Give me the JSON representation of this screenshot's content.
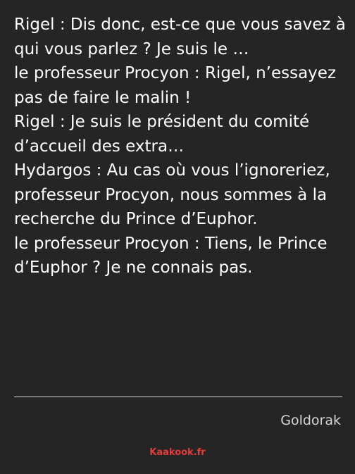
{
  "quote": {
    "lines": [
      "Rigel : Dis donc, est-ce que vous savez à qui vous parlez ? Je suis le …",
      "le professeur Procyon : Rigel, n’essayez pas de faire le malin !",
      "Rigel : Je suis le président du comité d’accueil des extra…",
      "Hydargos : Au cas où vous l’ignoreriez, professeur Procyon, nous sommes à la recherche du Prince d’Euphor.",
      "le professeur Procyon : Tiens, le Prince d’Euphor ? Je ne connais pas."
    ]
  },
  "author": "Goldorak",
  "site": "Kaakook.fr",
  "colors": {
    "background": "#252525",
    "text": "#ffffff",
    "site": "#e53b3b"
  }
}
